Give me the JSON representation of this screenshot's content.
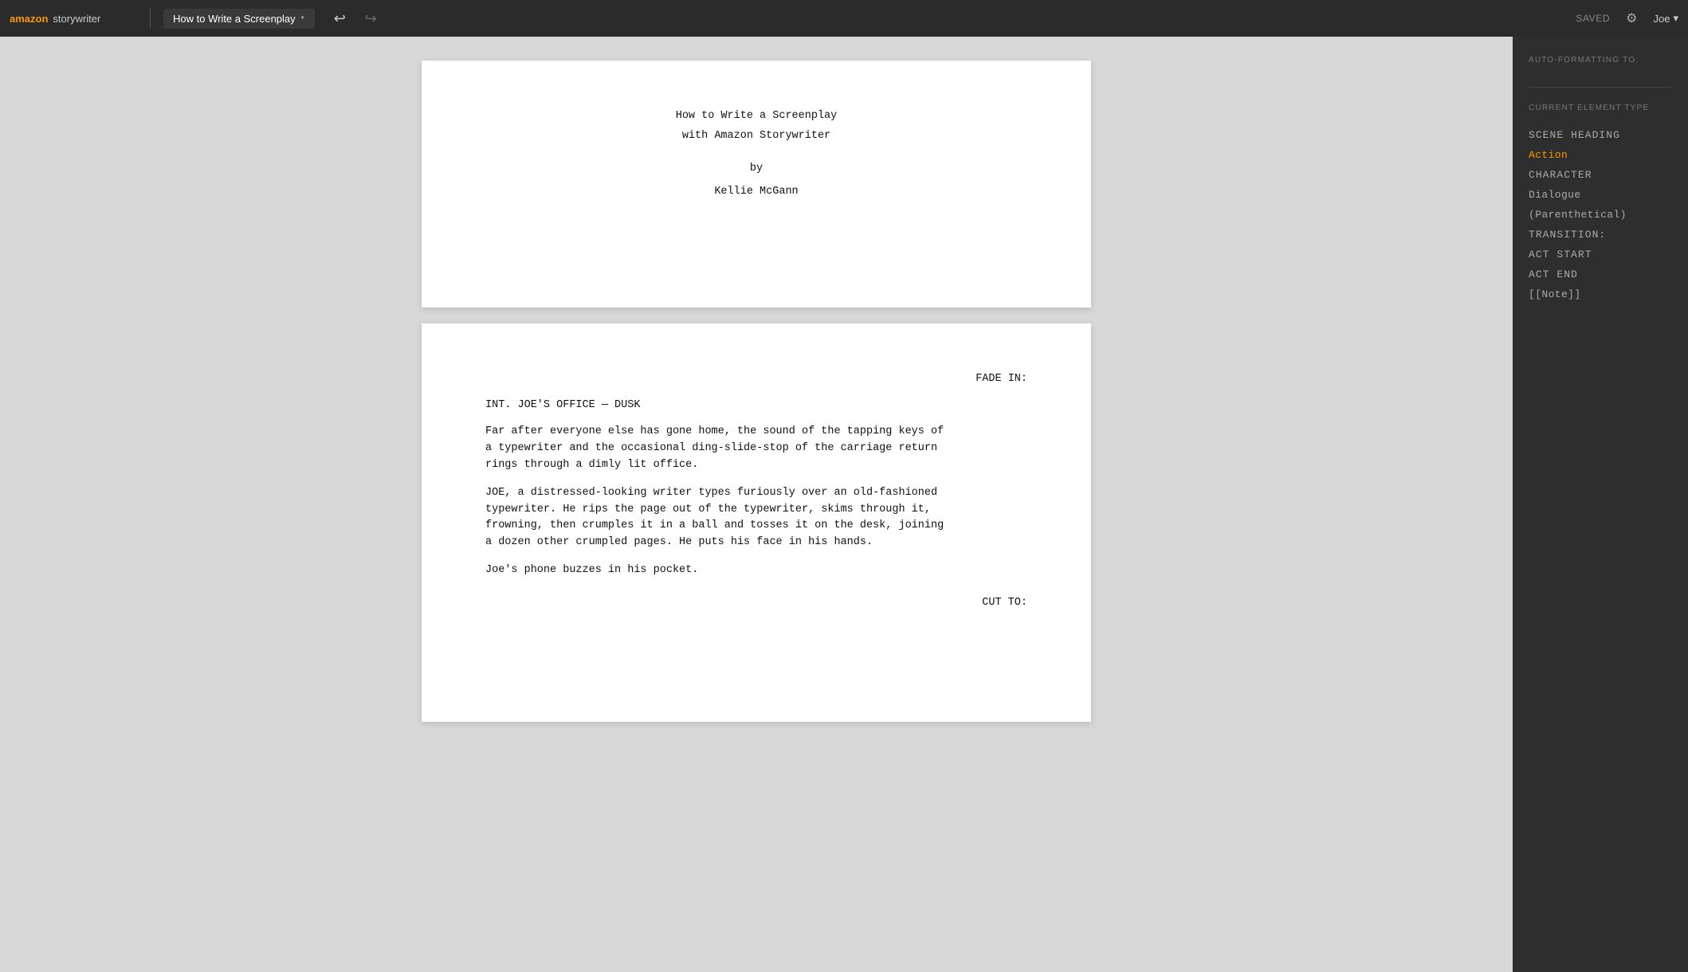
{
  "header": {
    "logo_amazon": "amazon",
    "logo_storywriter": "storywriter",
    "doc_title": "How to Write a Screenplay",
    "doc_caret": "▾",
    "undo_icon": "↩",
    "redo_icon": "↪",
    "saved_label": "SAVED",
    "gear_icon": "⚙",
    "user_label": "Joe",
    "user_caret": "▾"
  },
  "sidebar": {
    "auto_formatting_label": "AUTO-FORMATTING TO:",
    "current_element_label": "CURRENT ELEMENT TYPE",
    "element_types": [
      {
        "id": "scene-heading",
        "label": "SCENE HEADING",
        "active": false
      },
      {
        "id": "action",
        "label": "Action",
        "active": true
      },
      {
        "id": "character",
        "label": "CHARACTER",
        "active": false
      },
      {
        "id": "dialogue",
        "label": "Dialogue",
        "active": false
      },
      {
        "id": "parenthetical",
        "label": "(Parenthetical)",
        "active": false
      },
      {
        "id": "transition",
        "label": "TRANSITION:",
        "active": false
      },
      {
        "id": "act-start",
        "label": "ACT START",
        "active": false
      },
      {
        "id": "act-end",
        "label": "ACT END",
        "active": false
      },
      {
        "id": "note",
        "label": "[[Note]]",
        "active": false
      }
    ]
  },
  "title_page": {
    "title_line1": "How to Write a Screenplay",
    "title_line2": "with Amazon Storywriter",
    "by": "by",
    "author": "Kellie McGann"
  },
  "script_page": {
    "fade_in": "FADE IN:",
    "scene_heading": "INT. JOE'S office — DUSK",
    "action1": "Far after everyone else has gone home, the sound of the tapping keys of a typewriter and the occasional ding-slide-stop of the carriage return rings through a dimly lit office.",
    "action2": "JOE, a distressed-looking writer types furiously over an old-fashioned typewriter. He rips the page out of the typewriter, skims through it, frowning, then crumples it in a ball and tosses it on the desk, joining a dozen other crumpled pages. He puts his face in his hands.",
    "action3": "Joe's phone buzzes in his pocket.",
    "cut_to": "CUT TO:"
  }
}
